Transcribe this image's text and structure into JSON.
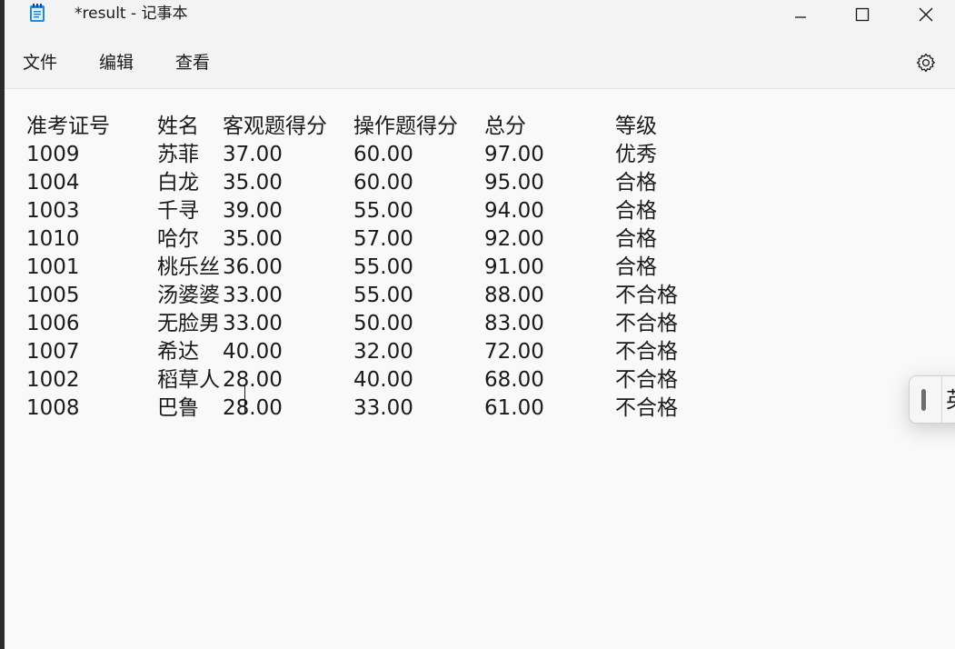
{
  "window": {
    "title": "*result - 记事本",
    "app_icon": "notepad-icon",
    "controls": [
      "minimize-icon",
      "maximize-icon",
      "close-icon"
    ]
  },
  "menu": {
    "items": [
      {
        "label": "文件"
      },
      {
        "label": "编辑"
      },
      {
        "label": "查看"
      }
    ],
    "settings_icon": "gear-icon"
  },
  "document": {
    "header": [
      "准考证号",
      "姓名",
      "客观题得分",
      "操作题得分",
      "总分",
      "等级"
    ],
    "rows": [
      [
        "1009",
        "苏菲",
        "37.00",
        "60.00",
        "97.00",
        "优秀"
      ],
      [
        "1004",
        "白龙",
        "35.00",
        "60.00",
        "95.00",
        "合格"
      ],
      [
        "1003",
        "千寻",
        "39.00",
        "55.00",
        "94.00",
        "合格"
      ],
      [
        "1010",
        "哈尔",
        "35.00",
        "57.00",
        "92.00",
        "合格"
      ],
      [
        "1001",
        "桃乐丝",
        "36.00",
        "55.00",
        "91.00",
        "合格"
      ],
      [
        "1005",
        "汤婆婆",
        "33.00",
        "55.00",
        "88.00",
        "不合格"
      ],
      [
        "1006",
        "无脸男",
        "33.00",
        "50.00",
        "83.00",
        "不合格"
      ],
      [
        "1007",
        "希达",
        "40.00",
        "32.00",
        "72.00",
        "不合格"
      ],
      [
        "1002",
        "稻草人",
        "28.00",
        "40.00",
        "68.00",
        "不合格"
      ],
      [
        "1008",
        "巴鲁",
        "28.00",
        "33.00",
        "61.00",
        "不合格"
      ]
    ]
  },
  "ime": {
    "mode_label": "英",
    "handle_icon": "drag-handle-icon"
  },
  "colors": {
    "chrome_bg": "#f3f3f3",
    "editor_bg": "#f9f9f9",
    "text": "#1a1a1a"
  }
}
